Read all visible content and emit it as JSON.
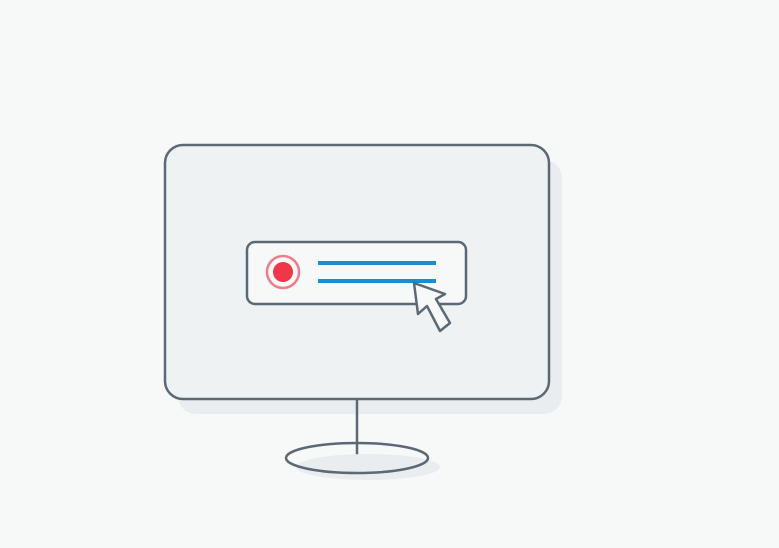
{
  "illustration": {
    "subject": "monitor-with-record-button-and-cursor",
    "colors": {
      "background": "#f7f8f8",
      "outline": "#5b6975",
      "screen_fill": "#eef2f3",
      "shadow": "#e9edef",
      "record_red": "#f0374a",
      "record_ring": "#f07c8a",
      "text_lines": "#1a8fcf",
      "card_fill": "#f7f8f8"
    },
    "icons": [
      "monitor-icon",
      "record-icon",
      "cursor-icon"
    ]
  }
}
